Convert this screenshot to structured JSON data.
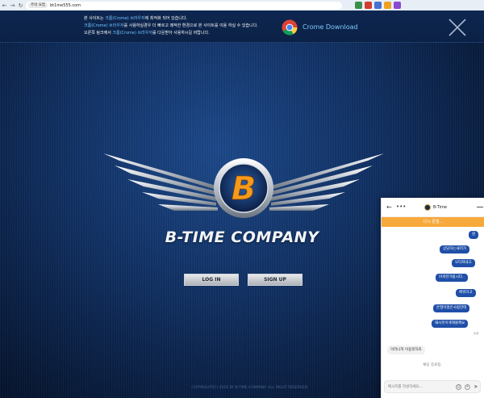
{
  "browser": {
    "security_label": "주의 요함",
    "url": "bt1me555.com",
    "back_glyph": "←",
    "forward_glyph": "→",
    "reload_glyph": "↻",
    "extension_icons": [
      {
        "name": "ext-icon-1",
        "color": "#3c8f4a"
      },
      {
        "name": "ext-icon-2",
        "color": "#d13c2f"
      },
      {
        "name": "ext-icon-3",
        "color": "#4a6fd1"
      },
      {
        "name": "ext-icon-4",
        "color": "#f0a020"
      },
      {
        "name": "ext-icon-5",
        "color": "#8a4ad1"
      }
    ]
  },
  "banner": {
    "line1_pre": "본 사이트는 ",
    "line1_hl": "크롬(Crome) 브라우저",
    "line1_post": "에 최적화 되어 있습니다.",
    "line2_hl": "크롬(Crome) 브라우저",
    "line2_post": "를 사용하실경우 더 빠르고 쾌적한 환경으로 본 사이트를 이용 하실 수 있습니다.",
    "line3_pre": "오른쪽 링크에서 ",
    "line3_hl": "크롬(Crome) 브라우저",
    "line3_post": "를 다운받아 사용하시길 바랍니다.",
    "download_label": "Crome Download",
    "accent": "#6fc3ff"
  },
  "main": {
    "brand_name": "B-TIME  COMPANY",
    "emblem_letter": "B",
    "login_label": "LOG IN",
    "signup_label": "SIGN UP",
    "copyright": "COPYRIGHT(C) 2016 BY B-TIME COMPANY. ALL RIGHT RESERVED."
  },
  "chat": {
    "back_glyph": "←",
    "more_glyph": "•••",
    "title": "B-Time",
    "reopen_label": "다시 문열...",
    "messages": [
      "뭔",
      "상담하는새끼가",
      "모타쳐내고",
      "야개한가봅시다..",
      "쩌워하고",
      "돈떨어졌은사람한테",
      "돼사웃이게해볼께요"
    ],
    "read_label": "읽음",
    "incoming": "이러니까 이용못하죠",
    "ended_label": "채팅 종료됨.",
    "input_placeholder": "메시지를 작성하세요..."
  }
}
